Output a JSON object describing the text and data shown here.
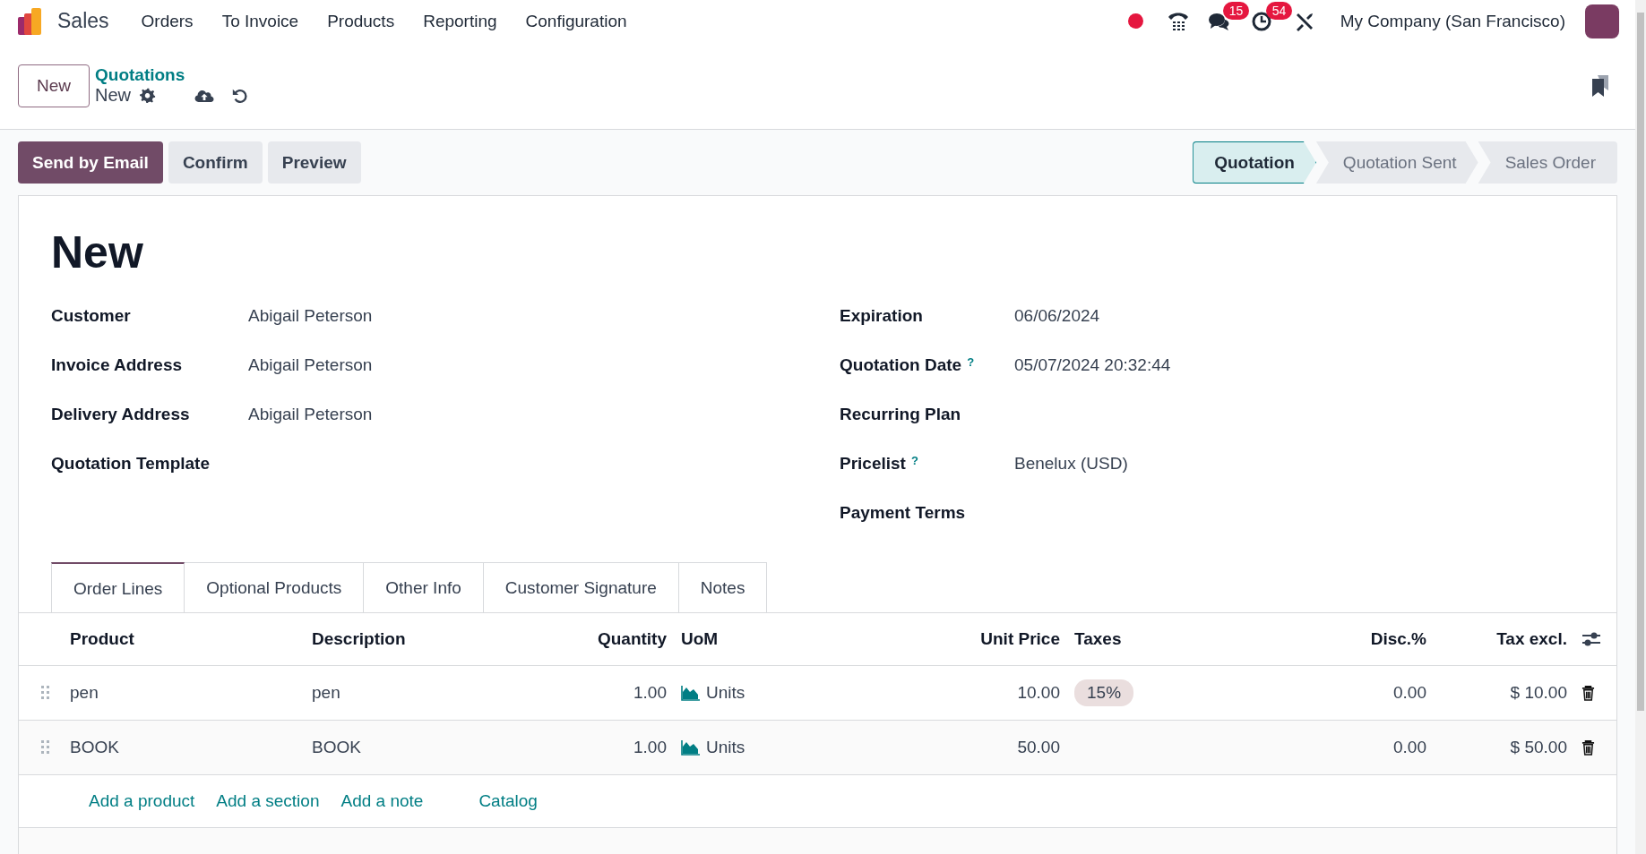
{
  "navbar": {
    "app": "Sales",
    "menu": [
      "Orders",
      "To Invoice",
      "Products",
      "Reporting",
      "Configuration"
    ],
    "messages_count": "15",
    "activities_count": "54",
    "company": "My Company (San Francisco)"
  },
  "control_panel": {
    "new_button": "New",
    "breadcrumb": "Quotations",
    "record": "New"
  },
  "actions": [
    {
      "label": "Send by Email",
      "kind": "primary"
    },
    {
      "label": "Confirm",
      "kind": "secondary"
    },
    {
      "label": "Preview",
      "kind": "secondary"
    }
  ],
  "status_steps": [
    {
      "label": "Quotation",
      "selected": true
    },
    {
      "label": "Quotation Sent",
      "selected": false
    },
    {
      "label": "Sales Order",
      "selected": false
    }
  ],
  "title": "New",
  "fields_left": [
    {
      "label": "Customer",
      "value": "Abigail Peterson"
    },
    {
      "label": "Invoice Address",
      "value": "Abigail Peterson"
    },
    {
      "label": "Delivery Address",
      "value": "Abigail Peterson"
    },
    {
      "label": "Quotation Template"
    }
  ],
  "fields_right": [
    {
      "label": "Expiration",
      "value": "06/06/2024"
    },
    {
      "label": "Quotation Date",
      "help": "?",
      "value": "05/07/2024 20:32:44"
    },
    {
      "label": "Recurring Plan"
    },
    {
      "label": "Pricelist",
      "help": "?",
      "value": "Benelux (USD)"
    },
    {
      "label": "Payment Terms"
    }
  ],
  "tabs": [
    {
      "label": "Order Lines",
      "selected": true
    },
    {
      "label": "Optional Products",
      "selected": false
    },
    {
      "label": "Other Info",
      "selected": false
    },
    {
      "label": "Customer Signature",
      "selected": false
    },
    {
      "label": "Notes",
      "selected": false
    }
  ],
  "table": {
    "columns": [
      "Product",
      "Description",
      "Quantity",
      "UoM",
      "Unit Price",
      "Taxes",
      "Disc.%",
      "Tax excl."
    ],
    "rows": [
      {
        "product": "pen",
        "description": "pen",
        "quantity": "1.00",
        "uom": "Units",
        "unit_price": "10.00",
        "taxes": [
          "15%"
        ],
        "discount": "0.00",
        "subtotal": "$ 10.00"
      },
      {
        "product": "BOOK",
        "description": "BOOK",
        "quantity": "1.00",
        "uom": "Units",
        "unit_price": "50.00",
        "discount": "0.00",
        "subtotal": "$ 50.00"
      }
    ],
    "add_links": [
      "Add a product",
      "Add a section",
      "Add a note",
      "Catalog"
    ]
  }
}
